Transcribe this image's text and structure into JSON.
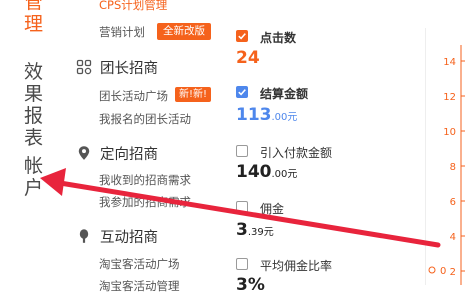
{
  "vertical_nav": {
    "manage_partial": "管理",
    "reports": "效果报表",
    "account": "帐户"
  },
  "cps_partial_link": "CPS计划管理",
  "marketing_plan": {
    "label": "营销计划",
    "badge": "全新改版",
    "badge_color": "#f5621c"
  },
  "sections": {
    "tuanzhang": {
      "title": "团长招商",
      "links": {
        "square": "团长活动广场",
        "mine": "我报名的团长活动"
      },
      "badge": "新!新!",
      "badge_color": "#f5621c",
      "icon": "grid-icon"
    },
    "dingxiang": {
      "title": "定向招商",
      "links": {
        "received": "我收到的招商需求",
        "joined": "我参加的招商需求"
      },
      "icon": "location-pin-icon"
    },
    "hudong": {
      "title": "互动招商",
      "links": {
        "square": "淘宝客活动广场",
        "partial": "淘宝客活动管理"
      },
      "icon": "balloon-icon"
    }
  },
  "metrics": {
    "clicks": {
      "label": "点击数",
      "checked": true,
      "value": "24",
      "color": "#f5621c"
    },
    "settlement": {
      "label": "结算金额",
      "checked": true,
      "value_int": "113",
      "value_dec": ".00元",
      "color": "#4e87ec"
    },
    "payment": {
      "label": "引入付款金额",
      "checked": false,
      "value_int": "140",
      "value_dec": ".00元"
    },
    "commission": {
      "label": "佣金",
      "checked": false,
      "value_int": "3",
      "value_dec": ".39元"
    },
    "avg_ratio": {
      "label": "平均佣金比率",
      "checked": false,
      "value_partial": "3%"
    }
  },
  "chart_data": {
    "type": "line",
    "axis_color": "#f5621c",
    "y_ticks": [
      "14",
      "12",
      "10",
      "8",
      "6",
      "4",
      "2"
    ],
    "x_tick_visible": "0"
  },
  "colors": {
    "accent": "#f5621c",
    "blue": "#4e87ec",
    "arrow": "#e8243c"
  }
}
